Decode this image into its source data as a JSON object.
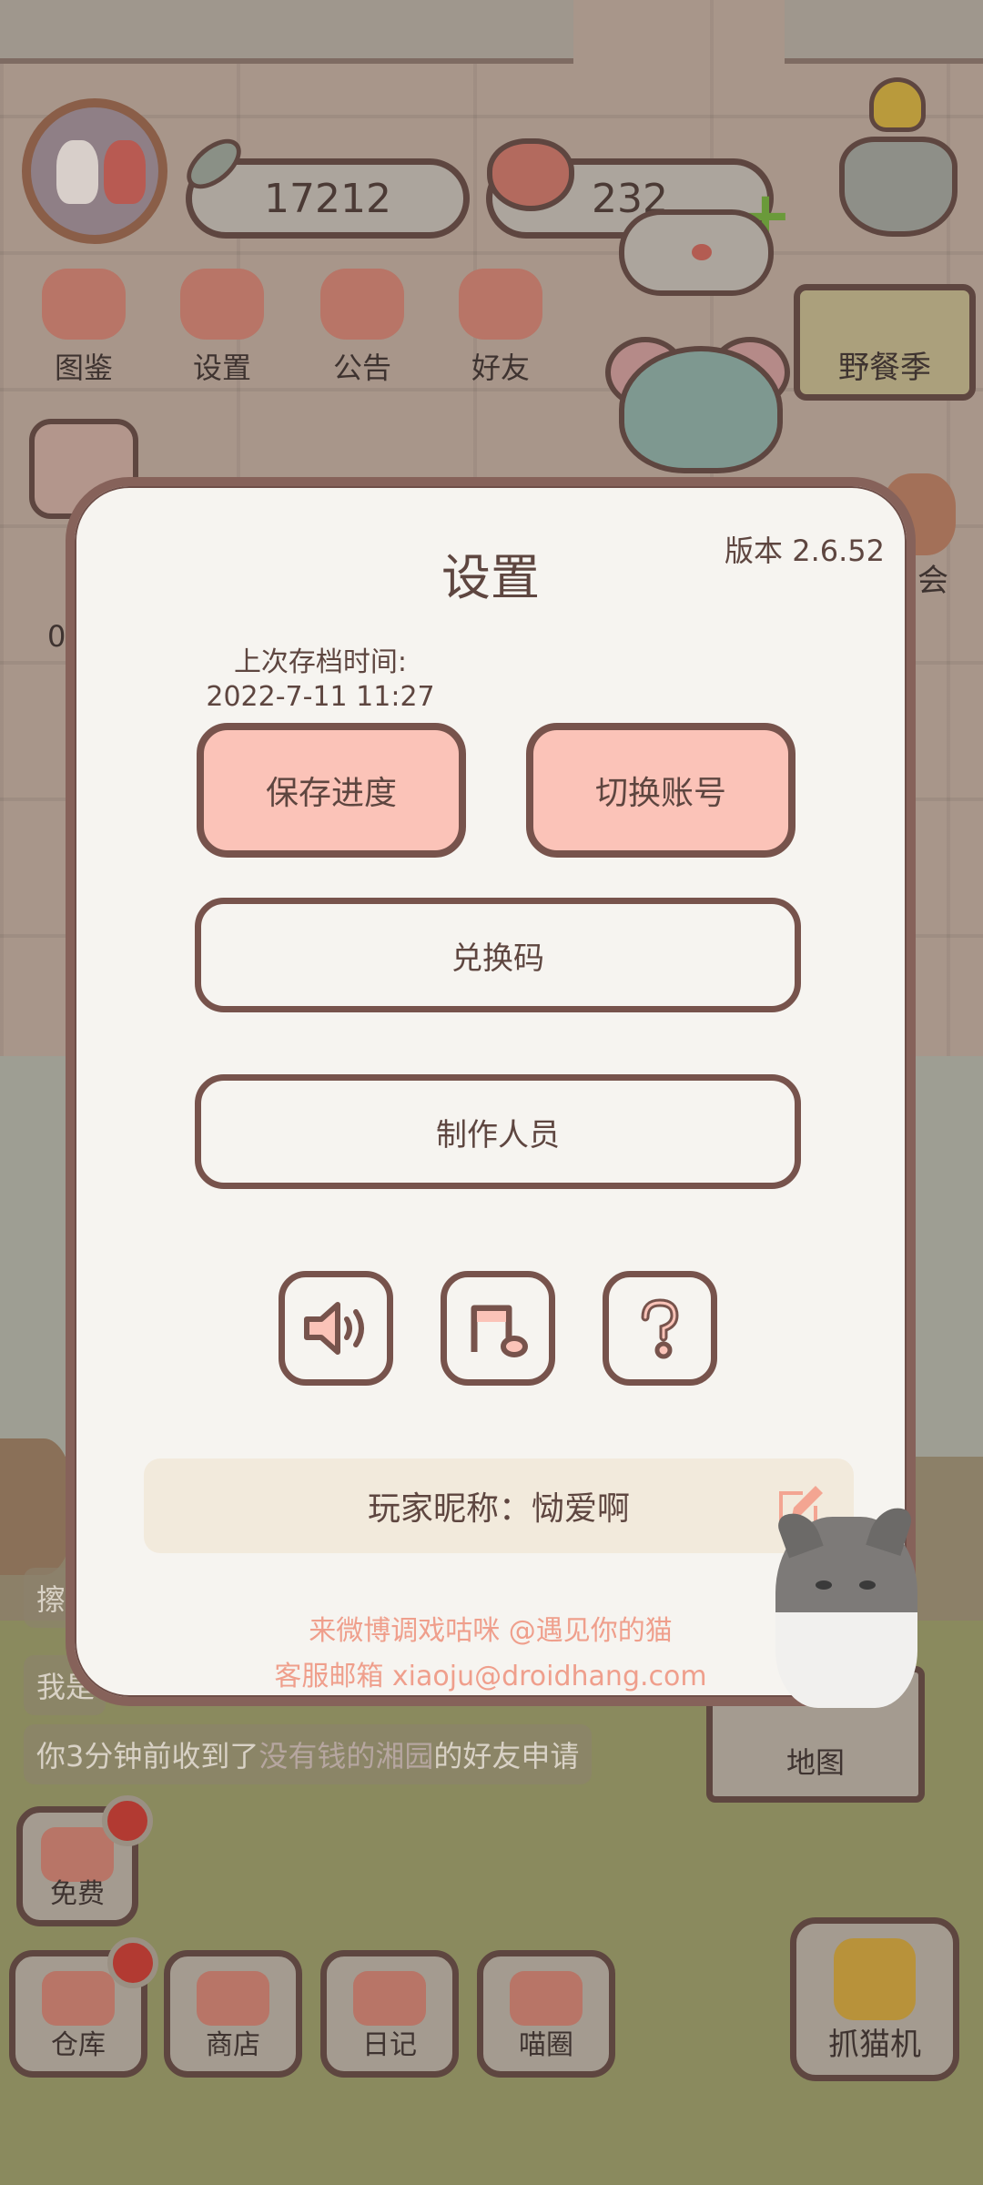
{
  "hud": {
    "fish_count": "17212",
    "heart_count": "232",
    "menu": [
      "图鉴",
      "设置",
      "公告",
      "好友"
    ],
    "event_label": "野餐季",
    "right_partial_label": "会",
    "left_partial_label": "0"
  },
  "chat": {
    "line1": "擦",
    "line2": "我是",
    "line3_prefix": "你3分钟前收到了",
    "line3_name": "没有钱的湘园",
    "line3_suffix": "的好友申请"
  },
  "bottom_bar": {
    "free": "免费",
    "warehouse": "仓库",
    "shop": "商店",
    "diary": "日记",
    "circle": "喵圈",
    "map": "地图",
    "claw": "抓猫机"
  },
  "settings": {
    "title": "设置",
    "version": "版本 2.6.52",
    "last_save_label": "上次存档时间:",
    "last_save_time": "2022-7-11 11:27",
    "save_button": "保存进度",
    "switch_account_button": "切换账号",
    "redeem_button": "兑换码",
    "credits_button": "制作人员",
    "icons": [
      "speaker-icon",
      "music-note-icon",
      "question-icon"
    ],
    "nickname_text": "玩家昵称：恸爱啊",
    "footer_weibo": "来微博调戏咕咪 @遇见你的猫",
    "footer_email": "客服邮箱 xiaoju@droidhang.com"
  },
  "colors": {
    "accent_pink": "#fbc3b8",
    "border_brown": "#77534c",
    "footer_link": "#ef9f8c"
  }
}
